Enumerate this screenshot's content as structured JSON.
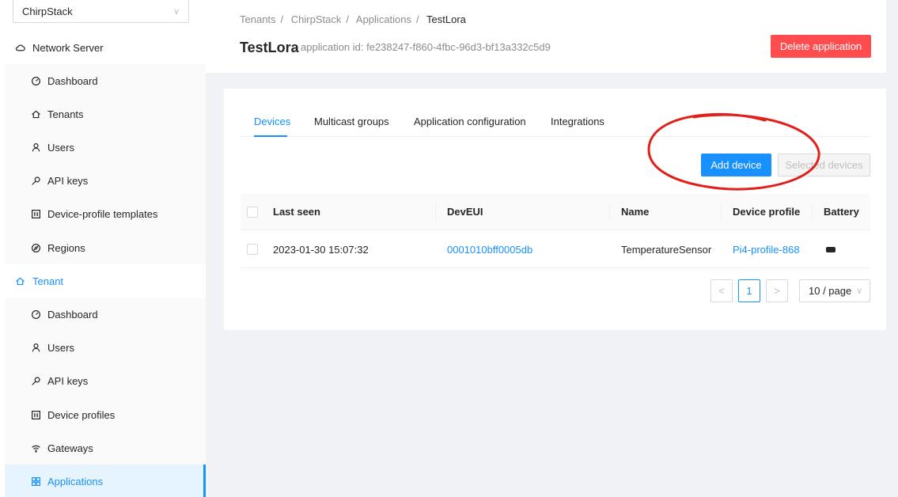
{
  "tenant_select": {
    "value": "ChirpStack"
  },
  "sidebar": {
    "network_server": {
      "label": "Network Server",
      "items": [
        {
          "label": "Dashboard",
          "icon": "dashboard-icon"
        },
        {
          "label": "Tenants",
          "icon": "home-icon"
        },
        {
          "label": "Users",
          "icon": "user-icon"
        },
        {
          "label": "API keys",
          "icon": "key-icon"
        },
        {
          "label": "Device-profile templates",
          "icon": "template-icon"
        },
        {
          "label": "Regions",
          "icon": "compass-icon"
        }
      ]
    },
    "tenant": {
      "label": "Tenant",
      "items": [
        {
          "label": "Dashboard",
          "icon": "dashboard-icon"
        },
        {
          "label": "Users",
          "icon": "user-icon"
        },
        {
          "label": "API keys",
          "icon": "key-icon"
        },
        {
          "label": "Device profiles",
          "icon": "profile-icon"
        },
        {
          "label": "Gateways",
          "icon": "wifi-icon"
        },
        {
          "label": "Applications",
          "icon": "appstore-icon"
        }
      ]
    }
  },
  "breadcrumb": [
    "Tenants",
    "ChirpStack",
    "Applications",
    "TestLora"
  ],
  "page": {
    "title": "TestLora",
    "subtitle": "application id: fe238247-f860-4fbc-96d3-bf13a332c5d9",
    "delete_label": "Delete application"
  },
  "tabs": [
    "Devices",
    "Multicast groups",
    "Application configuration",
    "Integrations"
  ],
  "actions": {
    "add_device": "Add device",
    "selected_devices": "Selected devices"
  },
  "table": {
    "headers": [
      "Last seen",
      "DevEUI",
      "Name",
      "Device profile",
      "Battery"
    ],
    "rows": [
      {
        "last_seen": "2023-01-30 15:07:32",
        "dev_eui": "0001010bff0005db",
        "name": "TemperatureSensor",
        "device_profile": "Pi4-profile-868",
        "battery": "battery-icon"
      }
    ]
  },
  "pagination": {
    "prev": "<",
    "current": "1",
    "next": ">",
    "page_size": "10 / page"
  },
  "colors": {
    "primary": "#1890ff",
    "danger": "#ff4d4f",
    "annotation": "#e0201b"
  }
}
